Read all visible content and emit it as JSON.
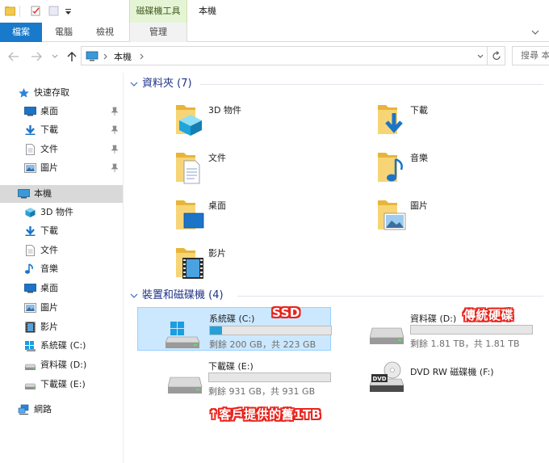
{
  "ribbon": {
    "contextual_tab_group": "磁碟機工具",
    "window_title": "本機",
    "tabs": [
      {
        "label": "檔案"
      },
      {
        "label": "電腦"
      },
      {
        "label": "檢視"
      },
      {
        "label": "管理"
      }
    ]
  },
  "address": {
    "location": "本機",
    "search_placeholder": "搜尋 本機"
  },
  "nav_pane": {
    "quick_access": "快速存取",
    "quick_items": [
      {
        "label": "桌面",
        "icon": "desktop-icon"
      },
      {
        "label": "下載",
        "icon": "download-icon"
      },
      {
        "label": "文件",
        "icon": "document-icon"
      },
      {
        "label": "圖片",
        "icon": "picture-icon"
      }
    ],
    "this_pc": "本機",
    "pc_items": [
      {
        "label": "3D 物件",
        "icon": "3d-objects-icon"
      },
      {
        "label": "下載",
        "icon": "download-icon"
      },
      {
        "label": "文件",
        "icon": "document-icon"
      },
      {
        "label": "音樂",
        "icon": "music-icon"
      },
      {
        "label": "桌面",
        "icon": "desktop-icon"
      },
      {
        "label": "圖片",
        "icon": "picture-icon"
      },
      {
        "label": "影片",
        "icon": "video-icon"
      },
      {
        "label": "系統碟 (C:)",
        "icon": "windows-drive-icon"
      },
      {
        "label": "資料碟 (D:)",
        "icon": "drive-icon"
      },
      {
        "label": "下載碟 (E:)",
        "icon": "drive-icon"
      }
    ],
    "network": "網路"
  },
  "main": {
    "folders_header": "資料夾 (7)",
    "folders": [
      {
        "label": "3D 物件"
      },
      {
        "label": "下載"
      },
      {
        "label": "文件"
      },
      {
        "label": "音樂"
      },
      {
        "label": "桌面"
      },
      {
        "label": "圖片"
      },
      {
        "label": "影片"
      }
    ],
    "devices_header": "裝置和磁碟機 (4)",
    "drives": [
      {
        "name": "系統碟 (C:)",
        "free": "剩餘 200 GB，共 223 GB",
        "used_fraction": 0.1
      },
      {
        "name": "資料碟 (D:)",
        "free": "剩餘 1.81 TB，共 1.81 TB",
        "used_fraction": 0.0
      },
      {
        "name": "下載碟 (E:)",
        "free": "剩餘 931 GB，共 931 GB",
        "used_fraction": 0.0
      },
      {
        "name": "DVD RW 磁碟機 (F:)"
      }
    ]
  },
  "annotations": {
    "ssd": "SSD",
    "traditional_hdd": "傳統硬碟",
    "customer_disk": "↑客戶提供的舊1TB"
  },
  "colors": {
    "accent": "#1979ca",
    "usage_bar": "#26a0da",
    "selection": "#cce8ff",
    "annotation": "#e8241c"
  }
}
